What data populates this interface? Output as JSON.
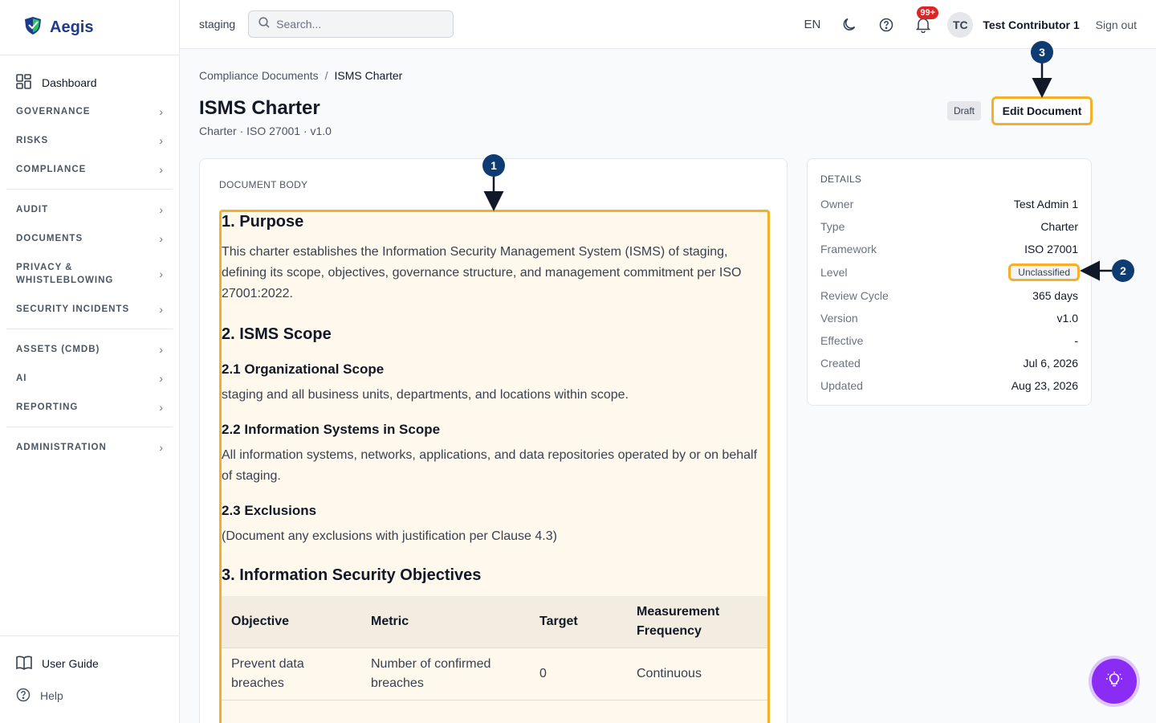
{
  "brand": {
    "name": "Aegis"
  },
  "sidebar": {
    "dashboard": "Dashboard",
    "sections": [
      {
        "label": "GOVERNANCE"
      },
      {
        "label": "RISKS"
      },
      {
        "label": "COMPLIANCE"
      },
      {
        "label": "AUDIT"
      },
      {
        "label": "DOCUMENTS"
      },
      {
        "label": "PRIVACY &",
        "label2": "WHISTLEBLOWING"
      },
      {
        "label": "SECURITY INCIDENTS"
      },
      {
        "label": "ASSETS (CMDB)"
      },
      {
        "label": "AI"
      },
      {
        "label": "REPORTING"
      },
      {
        "label": "ADMINISTRATION"
      }
    ],
    "user_guide": "User Guide",
    "help": "Help"
  },
  "header": {
    "env": "staging",
    "search_placeholder": "Search...",
    "lang": "EN",
    "notifications_count": "99+",
    "avatar_initials": "TC",
    "user_name": "Test Contributor 1",
    "sign_out": "Sign out"
  },
  "breadcrumb": {
    "parent": "Compliance Documents",
    "sep": "/",
    "current": "ISMS Charter"
  },
  "page": {
    "title": "ISMS Charter",
    "subtitle": "Charter · ISO 27001 · v1.0",
    "status": "Draft",
    "edit_button": "Edit Document"
  },
  "document": {
    "label": "DOCUMENT BODY",
    "h_purpose": "1. Purpose",
    "p_purpose": "This charter establishes the Information Security Management System (ISMS) of staging, defining its scope, objectives, governance structure, and management commitment per ISO 27001:2022.",
    "h_scope": "2. ISMS Scope",
    "h_org": "2.1 Organizational Scope",
    "p_org": "staging and all business units, departments, and locations within scope.",
    "h_systems": "2.2 Information Systems in Scope",
    "p_systems": "All information systems, networks, applications, and data repositories operated by or on behalf of staging.",
    "h_excl": "2.3 Exclusions",
    "p_excl": "(Document any exclusions with justification per Clause 4.3)",
    "h_objectives": "3. Information Security Objectives",
    "table": {
      "headers": [
        "Objective",
        "Metric",
        "Target",
        "Measurement Frequency"
      ],
      "rows": [
        [
          "Prevent data breaches",
          "Number of confirmed breaches",
          "0",
          "Continuous"
        ]
      ]
    }
  },
  "details": {
    "title": "DETAILS",
    "owner_k": "Owner",
    "owner_v": "Test Admin 1",
    "type_k": "Type",
    "type_v": "Charter",
    "framework_k": "Framework",
    "framework_v": "ISO 27001",
    "level_k": "Level",
    "level_v": "Unclassified",
    "review_k": "Review Cycle",
    "review_v": "365 days",
    "version_k": "Version",
    "version_v": "v1.0",
    "effective_k": "Effective",
    "effective_v": "-",
    "created_k": "Created",
    "created_v": "Jul 6, 2026",
    "updated_k": "Updated",
    "updated_v": "Aug 23, 2026"
  },
  "annotations": {
    "m1": "1",
    "m2": "2",
    "m3": "3"
  },
  "colors": {
    "accent_highlight": "#f5b027",
    "marker": "#0f3b73",
    "fab": "#8b2cf5",
    "brand": "#1e3a8a"
  }
}
